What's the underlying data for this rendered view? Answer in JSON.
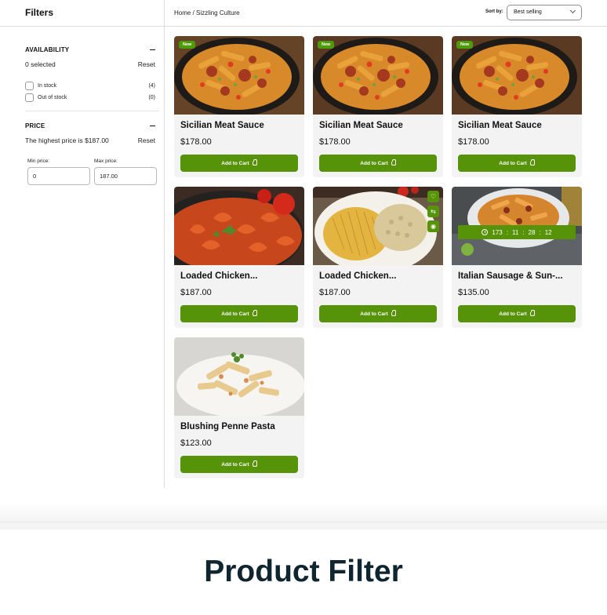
{
  "sidebar": {
    "title": "Filters",
    "availability": {
      "heading": "AVAILABILITY",
      "selected_text": "0 selected",
      "reset_label": "Reset",
      "options": [
        {
          "label": "In stock",
          "count": "(4)"
        },
        {
          "label": "Out of stock",
          "count": "(0)"
        }
      ]
    },
    "price": {
      "heading": "PRICE",
      "highest_text": "The highest price is $187.00",
      "reset_label": "Reset",
      "min_label": "Min price:",
      "max_label": "Max price:",
      "min_value": "0",
      "max_value": "187.00"
    }
  },
  "breadcrumb": {
    "home": "Home",
    "separator": "/",
    "current": "Sizzling Culture"
  },
  "sort": {
    "label": "Sort by:",
    "selected": "Best selling"
  },
  "products": [
    {
      "title": "Sicilian Meat Sauce",
      "price": "$178.00",
      "badge": "New",
      "image": "penne-sausage-pan"
    },
    {
      "title": "Sicilian Meat Sauce",
      "price": "$178.00",
      "badge": "New",
      "image": "penne-sausage-pan"
    },
    {
      "title": "Sicilian Meat Sauce",
      "price": "$178.00",
      "badge": "New",
      "image": "penne-sausage-pan"
    },
    {
      "title": "Loaded Chicken...",
      "price": "$187.00",
      "badge": "",
      "image": "pasta-tomato-pan"
    },
    {
      "title": "Loaded Chicken...",
      "price": "$187.00",
      "badge": "",
      "image": "plain-pasta-plate"
    },
    {
      "title": "Italian Sausage & Sun-...",
      "price": "$135.00",
      "badge": "",
      "image": "penne-bowl"
    },
    {
      "title": "Blushing Penne Pasta",
      "price": "$123.00",
      "badge": "",
      "image": "creamy-penne-plate"
    }
  ],
  "cart_label": "Add to Cart",
  "countdown": {
    "days": "173",
    "hours": "11",
    "minutes": "28",
    "seconds": "12",
    "separator": ":"
  },
  "icons": {
    "wishlist": "heart-icon",
    "compare": "compare-arrows-icon",
    "quickview": "eye-icon",
    "timer": "clock-icon",
    "cart": "basket-icon"
  },
  "colors": {
    "accent": "#579308",
    "badge": "#4f9a09",
    "card_bg": "#f3f3f3",
    "caption": "#0f2530"
  },
  "caption": "Product Filter"
}
